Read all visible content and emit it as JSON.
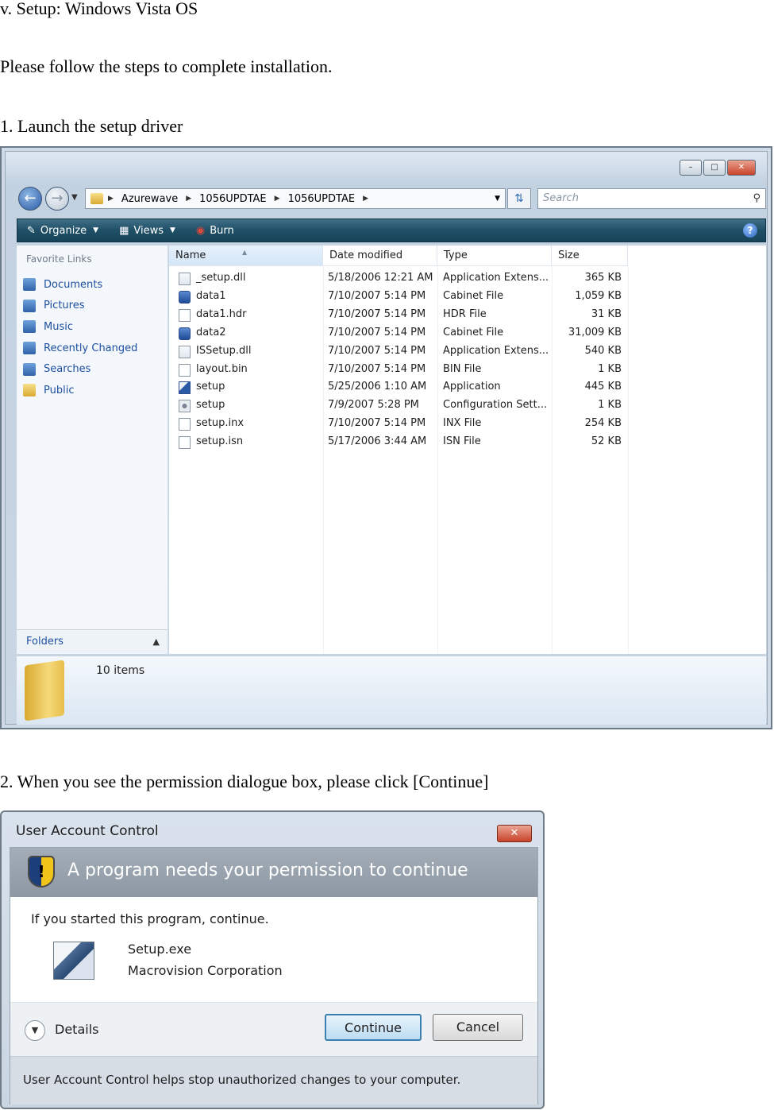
{
  "doc": {
    "heading": "v. Setup: Windows Vista OS",
    "intro": "Please follow the steps to complete installation.",
    "step1": "1. Launch the setup driver",
    "step2": "2. When you see the permission dialogue box, please click [Continue]"
  },
  "explorer": {
    "breadcrumb": [
      "Azurewave",
      "1056UPDTAE",
      "1056UPDTAE"
    ],
    "search_placeholder": "Search",
    "toolbar": {
      "organize": "Organize",
      "views": "Views",
      "burn": "Burn"
    },
    "favorites_title": "Favorite Links",
    "favorites": [
      "Documents",
      "Pictures",
      "Music",
      "Recently Changed",
      "Searches",
      "Public"
    ],
    "folders_label": "Folders",
    "columns": [
      "Name",
      "Date modified",
      "Type",
      "Size"
    ],
    "files": [
      {
        "name": "_setup.dll",
        "date": "5/18/2006 12:21 AM",
        "type": "Application Extens...",
        "size": "365 KB",
        "icon": "dll"
      },
      {
        "name": "data1",
        "date": "7/10/2007 5:14 PM",
        "type": "Cabinet File",
        "size": "1,059 KB",
        "icon": "cab"
      },
      {
        "name": "data1.hdr",
        "date": "7/10/2007 5:14 PM",
        "type": "HDR File",
        "size": "31 KB",
        "icon": "file"
      },
      {
        "name": "data2",
        "date": "7/10/2007 5:14 PM",
        "type": "Cabinet File",
        "size": "31,009 KB",
        "icon": "cab"
      },
      {
        "name": "ISSetup.dll",
        "date": "7/10/2007 5:14 PM",
        "type": "Application Extens...",
        "size": "540 KB",
        "icon": "dll"
      },
      {
        "name": "layout.bin",
        "date": "7/10/2007 5:14 PM",
        "type": "BIN File",
        "size": "1 KB",
        "icon": "file"
      },
      {
        "name": "setup",
        "date": "5/25/2006 1:10 AM",
        "type": "Application",
        "size": "445 KB",
        "icon": "app"
      },
      {
        "name": "setup",
        "date": "7/9/2007 5:28 PM",
        "type": "Configuration Sett...",
        "size": "1 KB",
        "icon": "cfg"
      },
      {
        "name": "setup.inx",
        "date": "7/10/2007 5:14 PM",
        "type": "INX File",
        "size": "254 KB",
        "icon": "file"
      },
      {
        "name": "setup.isn",
        "date": "5/17/2006 3:44 AM",
        "type": "ISN File",
        "size": "52 KB",
        "icon": "file"
      }
    ],
    "item_count": "10 items"
  },
  "uac": {
    "title": "User Account Control",
    "heading": "A program needs your permission to continue",
    "line1": "If you started this program, continue.",
    "program_name": "Setup.exe",
    "publisher": "Macrovision Corporation",
    "details_label": "Details",
    "continue_label": "Continue",
    "cancel_label": "Cancel",
    "footer": "User Account Control helps stop unauthorized changes to your computer."
  }
}
